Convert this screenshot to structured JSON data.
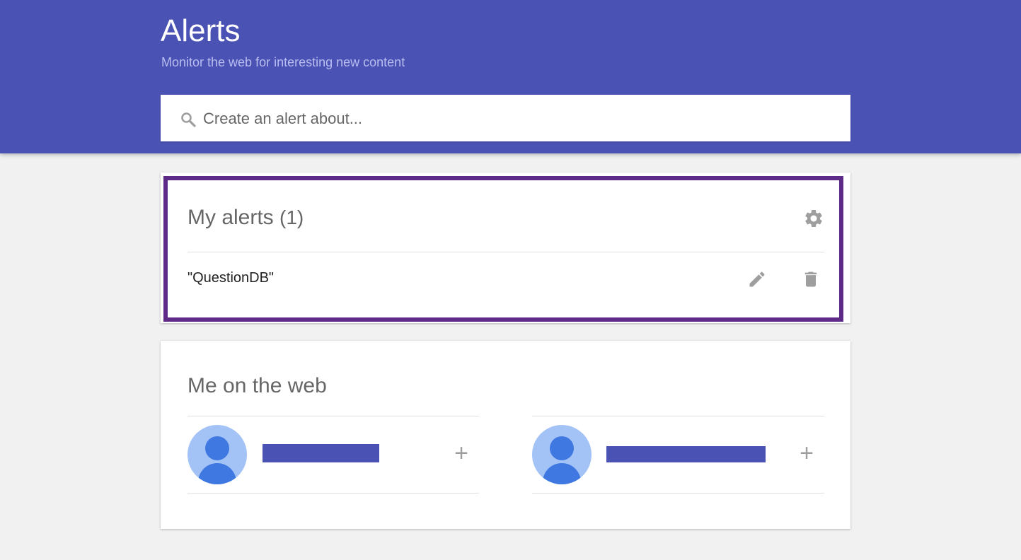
{
  "header": {
    "title": "Alerts",
    "subtitle": "Monitor the web for interesting new content",
    "background_color": "#4a52b4"
  },
  "search": {
    "placeholder": "Create an alert about...",
    "value": "",
    "icon": "search-icon"
  },
  "my_alerts": {
    "title": "My alerts",
    "count": "(1)",
    "settings_icon": "gear-icon",
    "highlight_color": "#5e2a87",
    "items": [
      {
        "label": "\"QuestionDB\"",
        "edit_icon": "pencil-icon",
        "delete_icon": "trash-icon"
      }
    ]
  },
  "me_on_the_web": {
    "title": "Me on the web",
    "entries": [
      {
        "avatar_icon": "person-icon",
        "name_redacted": true,
        "add_symbol": "+"
      },
      {
        "avatar_icon": "person-icon",
        "name_redacted": true,
        "add_symbol": "+"
      }
    ]
  }
}
